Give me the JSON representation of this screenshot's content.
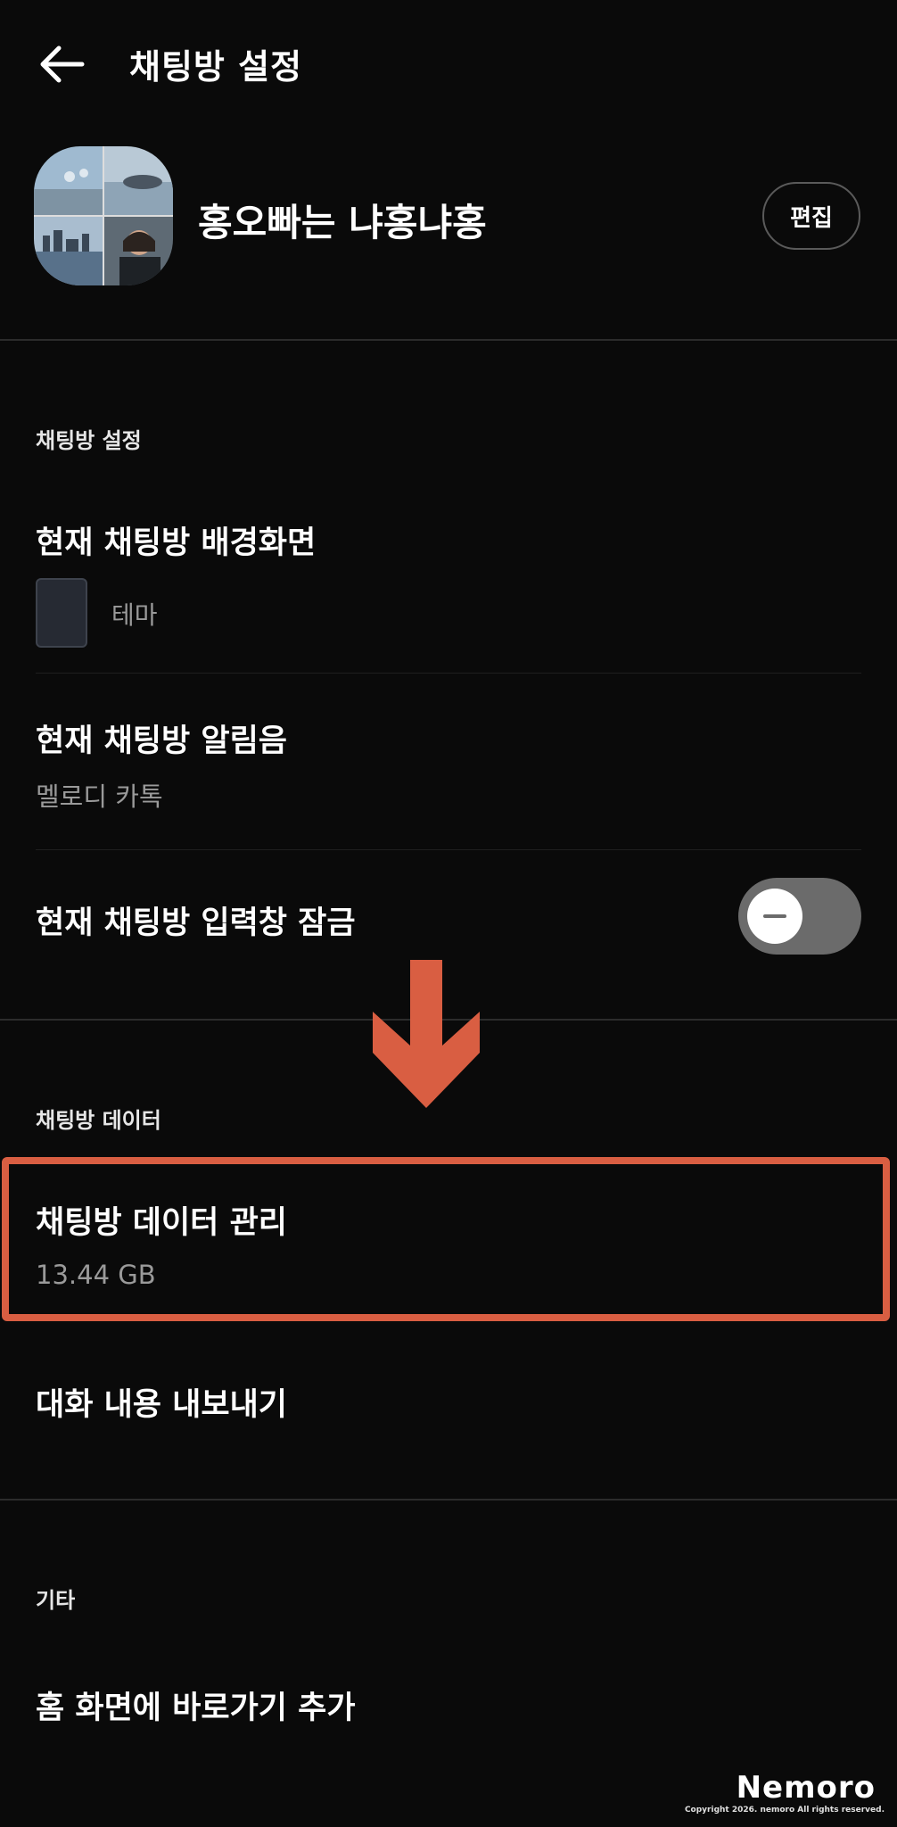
{
  "header": {
    "back_icon": "arrow-left-icon",
    "title": "채팅방 설정"
  },
  "profile": {
    "name": "홍오빠는 냐홍냐홍",
    "edit_label": "편집"
  },
  "sections": {
    "chat_settings": {
      "label": "채팅방 설정",
      "background": {
        "title": "현재 채팅방 배경화면",
        "value": "테마"
      },
      "notification": {
        "title": "현재 채팅방 알림음",
        "value": "멜로디 카톡"
      },
      "input_lock": {
        "title": "현재 채팅방 입력창 잠금",
        "toggle_on": false
      }
    },
    "chat_data": {
      "label": "채팅방 데이터",
      "manage": {
        "title": "채팅방 데이터 관리",
        "value": "13.44 GB"
      },
      "export": {
        "title": "대화 내용 내보내기"
      }
    },
    "other": {
      "label": "기타",
      "shortcut": {
        "title": "홈 화면에 바로가기 추가"
      }
    }
  },
  "annotation": {
    "highlight_color": "#d95e42",
    "arrow_icon": "arrow-down-icon"
  },
  "watermark": {
    "brand": "Nemoro",
    "copyright": "Copyright 2026. nemoro All rights reserved."
  }
}
